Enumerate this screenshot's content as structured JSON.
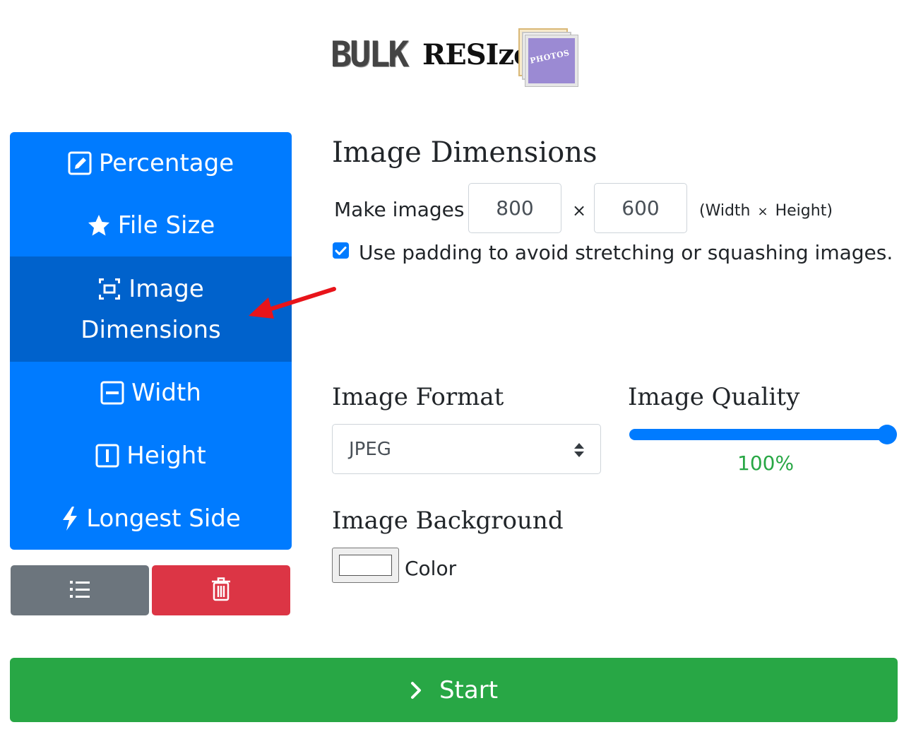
{
  "logo": {
    "bulk": "BULK",
    "resize": "RESIze",
    "photos": "PHOTOS"
  },
  "menu": {
    "items": [
      {
        "label": "Percentage",
        "icon": "pencil-square-icon"
      },
      {
        "label": "File Size",
        "icon": "star-icon"
      },
      {
        "label_line1": "Image",
        "label_line2": "Dimensions",
        "icon": "bounding-box-icon",
        "active": true
      },
      {
        "label": "Width",
        "icon": "dash-square-icon"
      },
      {
        "label": "Height",
        "icon": "i-square-icon"
      },
      {
        "label": "Longest Side",
        "icon": "lightning-icon"
      }
    ]
  },
  "actions": {
    "list_icon": "list-icon",
    "delete_icon": "trash-icon"
  },
  "dimensions": {
    "heading": "Image Dimensions",
    "make_label": "Make images",
    "width_value": "800",
    "times": "×",
    "height_value": "600",
    "hint_open": "(Width",
    "hint_times": "×",
    "hint_close": "Height)",
    "padding_checked": true,
    "padding_label": "Use padding to avoid stretching or squashing images."
  },
  "format": {
    "heading": "Image Format",
    "selected": "JPEG"
  },
  "quality": {
    "heading": "Image Quality",
    "value_text": "100%",
    "value": 100
  },
  "background": {
    "heading": "Image Background",
    "color_label": "Color",
    "color_value": "#ffffff"
  },
  "start": {
    "label": "Start"
  },
  "colors": {
    "primary": "#007bff",
    "primary_active": "#0062cc",
    "secondary": "#6c757d",
    "danger": "#dc3545",
    "success": "#28a745",
    "annotation": "#e8141a"
  }
}
